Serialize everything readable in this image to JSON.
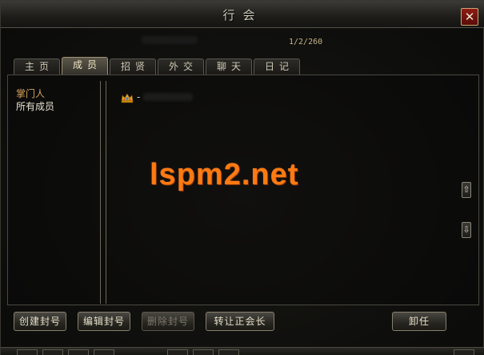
{
  "window": {
    "title": "行会",
    "close_label": "✕"
  },
  "header": {
    "member_count": "1/2/260"
  },
  "tabs": [
    {
      "label": "主页",
      "active": false
    },
    {
      "label": "成员",
      "active": true
    },
    {
      "label": "招贤",
      "active": false
    },
    {
      "label": "外交",
      "active": false
    },
    {
      "label": "聊天",
      "active": false
    },
    {
      "label": "日记",
      "active": false
    }
  ],
  "ranks": [
    {
      "label": "掌门人",
      "highlight": true
    },
    {
      "label": "所有成员",
      "highlight": false
    }
  ],
  "member": {
    "dash": "-",
    "icon": "crown-icon"
  },
  "watermark": "lspm2.net",
  "scroll": {
    "up": "⇧",
    "down": "⇩"
  },
  "buttons": {
    "create_title": "创建封号",
    "edit_title": "编辑封号",
    "delete_title": "删除封号",
    "transfer_leader": "转让正会长",
    "unload": "卸任"
  },
  "colors": {
    "accent_orange": "#ff7a12",
    "highlight_rank": "#d6a25a",
    "close_red": "#8e1c14"
  }
}
